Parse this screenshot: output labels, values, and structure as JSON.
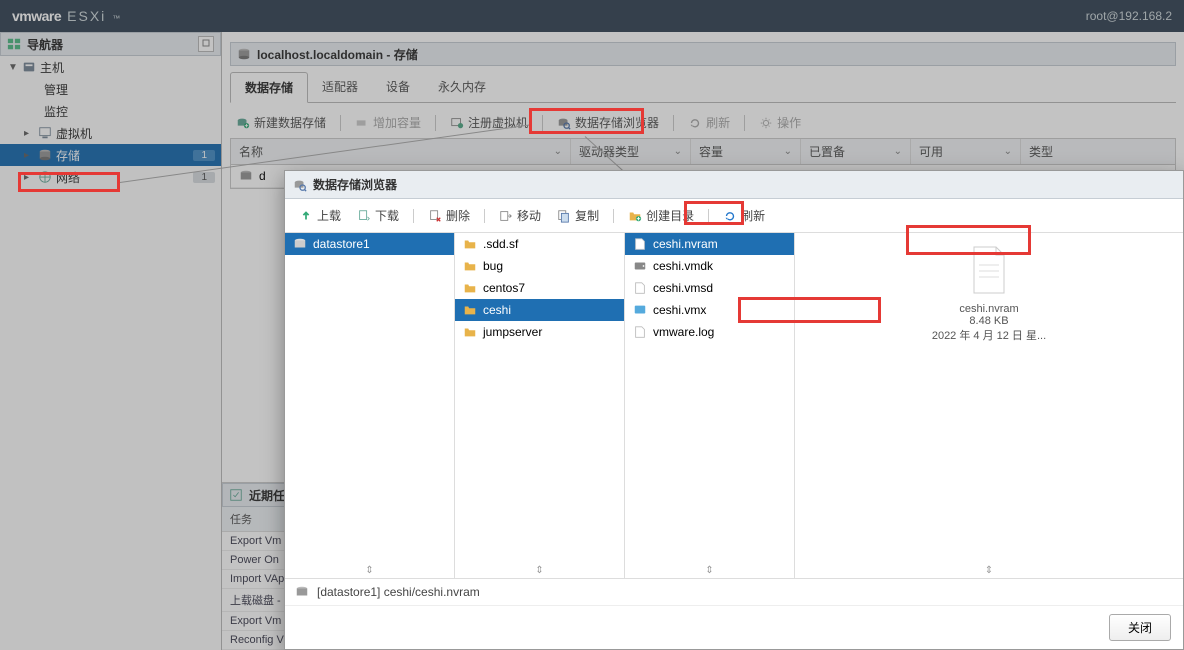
{
  "brand": {
    "vm": "vmware",
    "esxi": "ESXi",
    "tm": "™"
  },
  "user": {
    "text": "root@192.168.2"
  },
  "sidebar": {
    "title": "导航器",
    "items": [
      {
        "label": "主机",
        "name": "host",
        "expand": "▼"
      },
      {
        "label": "管理",
        "name": "manage"
      },
      {
        "label": "监控",
        "name": "monitor"
      },
      {
        "label": "虚拟机",
        "name": "vms",
        "expand": "▸",
        "badge": ""
      },
      {
        "label": "存储",
        "name": "storage",
        "expand": "▸",
        "badge": "1",
        "selected": true
      },
      {
        "label": "网络",
        "name": "network",
        "expand": "▸",
        "badge": "1"
      }
    ]
  },
  "content": {
    "header_title": "localhost.localdomain - 存储",
    "tabs": [
      {
        "label": "数据存储",
        "active": true
      },
      {
        "label": "适配器"
      },
      {
        "label": "设备"
      },
      {
        "label": "永久内存"
      }
    ],
    "toolbar": {
      "new_ds": "新建数据存储",
      "increase": "增加容量",
      "register_vm": "注册虚拟机",
      "ds_browser": "数据存储浏览器",
      "refresh": "刷新",
      "actions": "操作"
    },
    "grid": {
      "cols": [
        "名称",
        "驱动器类型",
        "容量",
        "已置备",
        "可用",
        "类型"
      ],
      "row0": {
        "name": "d"
      }
    }
  },
  "recent": {
    "title": "近期任",
    "header": "任务",
    "items": [
      "Export Vm",
      "Power On",
      "Import VAp",
      "上载磁盘 -",
      "Export Vm",
      "Reconfig V"
    ]
  },
  "modal": {
    "title": "数据存储浏览器",
    "toolbar": {
      "upload": "上载",
      "download": "下载",
      "delete": "删除",
      "move": "移动",
      "copy": "复制",
      "mkdir": "创建目录",
      "refresh": "刷新"
    },
    "col0": [
      {
        "label": "datastore1",
        "selected": true,
        "icon": "datastore"
      }
    ],
    "col1": [
      {
        "label": ".sdd.sf",
        "icon": "folder"
      },
      {
        "label": "bug",
        "icon": "folder"
      },
      {
        "label": "centos7",
        "icon": "folder"
      },
      {
        "label": "ceshi",
        "icon": "folder",
        "selected": true
      },
      {
        "label": "jumpserver",
        "icon": "folder"
      }
    ],
    "col2": [
      {
        "label": "ceshi.nvram",
        "icon": "file",
        "selected": true
      },
      {
        "label": "ceshi.vmdk",
        "icon": "disk"
      },
      {
        "label": "ceshi.vmsd",
        "icon": "file"
      },
      {
        "label": "ceshi.vmx",
        "icon": "vmx"
      },
      {
        "label": "vmware.log",
        "icon": "file"
      }
    ],
    "details": {
      "name": "ceshi.nvram",
      "size": "8.48 KB",
      "date": "2022 年 4 月 12 日 星..."
    },
    "status_path": "[datastore1] ceshi/ceshi.nvram",
    "close_btn": "关闭"
  }
}
